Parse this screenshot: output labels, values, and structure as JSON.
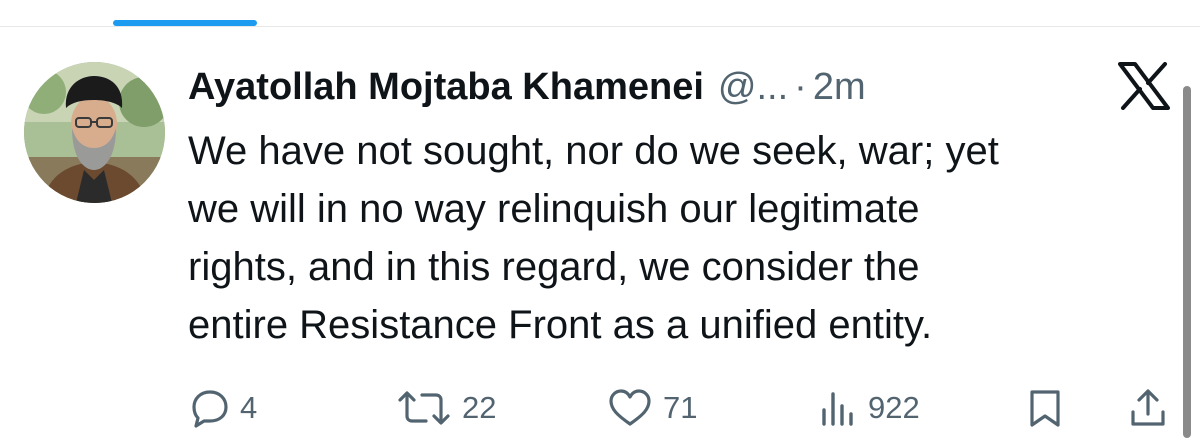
{
  "tweet": {
    "author_name": "Ayatollah Mojtaba Khamenei",
    "handle": "@...",
    "separator": "·",
    "timestamp": "2m",
    "text_lines": [
      "We have not sought, nor do we seek, war; yet",
      "we will in no way relinquish our legitimate",
      "rights, and in this regard, we consider the",
      "entire Resistance Front as a unified entity."
    ]
  },
  "actions": {
    "replies": "4",
    "reposts": "22",
    "likes": "71",
    "views": "922"
  },
  "icons": {
    "platform": "x-logo-icon",
    "reply": "reply-icon",
    "repost": "repost-icon",
    "like": "heart-icon",
    "views": "views-icon",
    "bookmark": "bookmark-icon",
    "share": "share-icon"
  },
  "colors": {
    "text": "#0f1419",
    "secondary": "#536471",
    "accent": "#1d9bf0"
  }
}
